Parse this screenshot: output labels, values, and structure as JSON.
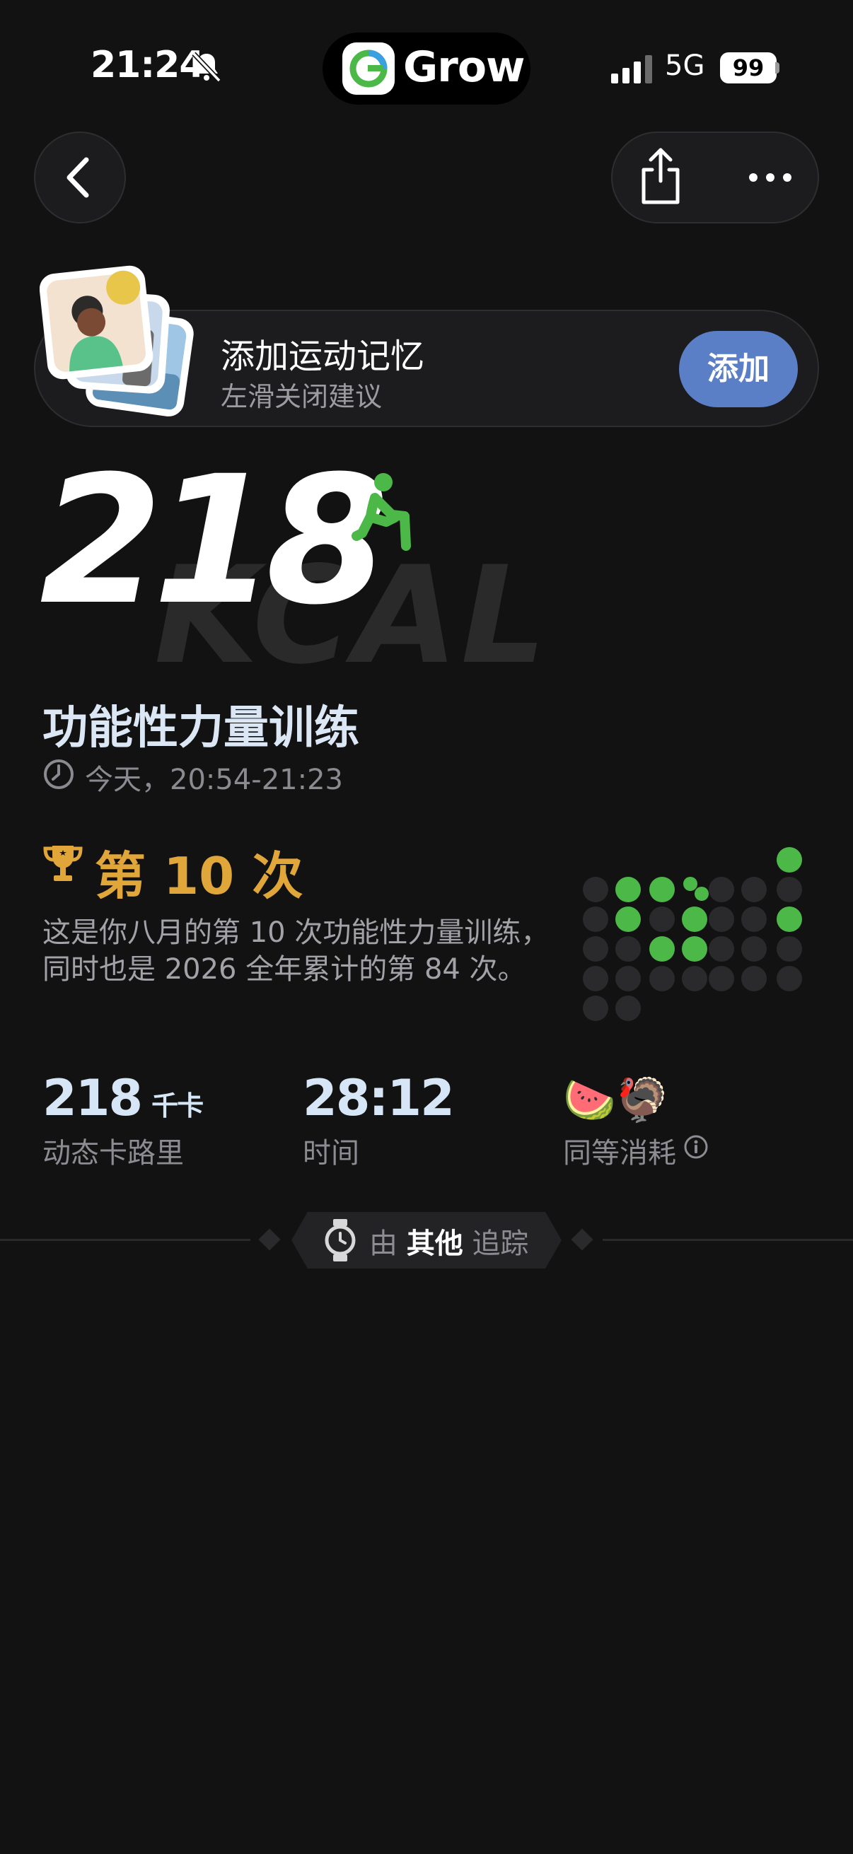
{
  "status_bar": {
    "time": "21:24",
    "network": "5G",
    "battery": "99"
  },
  "app": {
    "name": "Grow"
  },
  "suggestion": {
    "title": "添加运动记忆",
    "subtitle": "左滑关闭建议",
    "add_label": "添加"
  },
  "summary": {
    "calories": "218",
    "unit_watermark": "KCAL"
  },
  "workout": {
    "name": "功能性力量训练",
    "time_range": "今天，20:54-21:23"
  },
  "achievement": {
    "title": "第 10 次",
    "line1": "这是你八月的第 10 次功能性力量训练，",
    "line2": "同时也是 2026 全年累计的第 84 次。",
    "accent": "#e0a63a"
  },
  "stats": {
    "calories": {
      "value": "218",
      "unit": "千卡",
      "label": "动态卡路里"
    },
    "duration": {
      "value": "28:12",
      "label": "时间"
    },
    "equivalent": {
      "emoji": "🍉🦃",
      "label": "同等消耗"
    }
  },
  "tracker": {
    "prefix": "由",
    "source": "其他",
    "suffix": "追踪"
  },
  "colors": {
    "accent_green": "#4cb848",
    "button_blue": "#5b7fc7",
    "dot_inactive": "#2a2a2c"
  },
  "icons": [
    "bell-slash-icon",
    "app-logo-icon",
    "signal-icon",
    "chevron-left-icon",
    "share-icon",
    "more-icon",
    "runner-icon",
    "clock-icon",
    "trophy-icon",
    "info-icon",
    "watch-icon"
  ]
}
